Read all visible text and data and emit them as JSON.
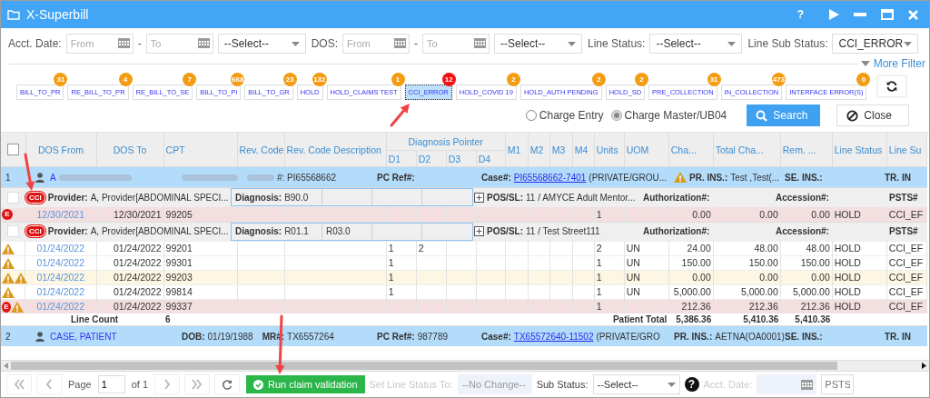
{
  "window": {
    "title": "X-Superbill"
  },
  "title_controls": [
    {
      "kind": "help",
      "label": "?"
    },
    {
      "kind": "play"
    },
    {
      "kind": "minimize"
    },
    {
      "kind": "maximize"
    },
    {
      "kind": "close"
    }
  ],
  "filters": [
    {
      "kind": "date_range",
      "label": "Acct. Date:",
      "from": {
        "placeholder": "From"
      },
      "separator": "-",
      "to": {
        "placeholder": "To"
      },
      "select": "--Select--"
    },
    {
      "kind": "date_range",
      "label": "DOS:",
      "from": {
        "placeholder": "From"
      },
      "separator": "-",
      "to": {
        "placeholder": "To"
      },
      "select": "--Select--"
    },
    {
      "kind": "select",
      "label": "Line Status:",
      "value": "--Select--"
    },
    {
      "kind": "select",
      "label": "Line Sub Status:",
      "value": "CCI_ERROR"
    }
  ],
  "more_filter": "More Filter",
  "status_chips": [
    {
      "label": "BILL_TO_PR",
      "count": "31",
      "selected": false
    },
    {
      "label": "RE_BILL_TO_PR",
      "count": "4",
      "selected": false
    },
    {
      "label": "RE_BILL_TO_SE",
      "count": "7",
      "selected": false
    },
    {
      "label": "BILL_TO_PI",
      "count": "668",
      "selected": false
    },
    {
      "label": "BILL_TO_GR",
      "count": "23",
      "selected": false
    },
    {
      "label": "HOLD",
      "count": "132",
      "selected": false
    },
    {
      "label": "HOLD_CLAIMS TEST",
      "count": "1",
      "selected": false
    },
    {
      "label": "CCI_ERROR",
      "count": "12",
      "selected": true,
      "arrow": true
    },
    {
      "label": "HOLD_COVID 19",
      "count": "2",
      "selected": false
    },
    {
      "label": "HOLD_AUTH PENDING",
      "count": "2",
      "selected": false
    },
    {
      "label": "HOLD_SD",
      "count": "2",
      "selected": false
    },
    {
      "label": "PRE_COLLECTION",
      "count": "31",
      "selected": false
    },
    {
      "label": "IN_COLLECTION",
      "count": "473",
      "selected": false
    },
    {
      "label": "INTERFACE ERROR(S)",
      "count": "0",
      "selected": false
    }
  ],
  "entry_modes": [
    {
      "label": "Charge Entry",
      "selected": false
    },
    {
      "label": "Charge Master/UB04",
      "selected": true
    }
  ],
  "buttons": [
    {
      "kind": "search",
      "label": "Search"
    },
    {
      "kind": "close",
      "label": "Close"
    }
  ],
  "table": {
    "all_checked": false,
    "columns": [
      {
        "label": "DOS From"
      },
      {
        "label": "DOS To"
      },
      {
        "label": "CPT"
      },
      {
        "label": "Rev. Code"
      },
      {
        "label": "Rev. Code Description"
      },
      {
        "label": "Diagnosis Pointer",
        "children": [
          {
            "label": "D1"
          },
          {
            "label": "D2"
          },
          {
            "label": "D3"
          },
          {
            "label": "D4"
          }
        ]
      },
      {
        "label": "M1"
      },
      {
        "label": "M2"
      },
      {
        "label": "M3"
      },
      {
        "label": "M4"
      },
      {
        "label": "Units"
      },
      {
        "label": "UOM"
      },
      {
        "label": "Cha..."
      },
      {
        "label": "Total Cha..."
      },
      {
        "label": "Rem. ..."
      },
      {
        "label": "Line Status"
      },
      {
        "label": "Line Su"
      }
    ],
    "patients": [
      {
        "number": "1",
        "name": "A",
        "redacted": true,
        "id_fields": [
          {
            "redacted": true
          },
          {
            "redacted": true,
            "value": "#: PI65568662"
          }
        ],
        "fields": [
          {
            "label": "PC Ref#:",
            "warning": false
          },
          {
            "label": "Case#:",
            "link": "PI65568662-7401",
            "value": "(PRIVATE/GROU...",
            "warning": false
          },
          {
            "label": "PR. INS.:",
            "value": "Test ,Test(...",
            "warning": true
          },
          {
            "label": "SE. INS.:",
            "warning": false
          },
          {
            "label": "TR. IN",
            "warning": false
          }
        ],
        "groups": [
          {
            "badge": "CCI",
            "arrow": true,
            "checked": false,
            "provider_label": "Provider:",
            "provider": "A, Provider[ABDOMINAL SPECI...",
            "diagnosis_label": "Diagnosis:",
            "diagnoses": [
              "B90.0"
            ],
            "pos_label": "POS/SL:",
            "pos": "11 / AMYCE Adult Mentor...",
            "authorization": "Authorization#:",
            "accession": "Accession#:",
            "psts": "PSTS#",
            "lines": [
              {
                "kind": "error",
                "flags": [
                  {
                    "kind": "error",
                    "label": "E"
                  }
                ],
                "dos_from": "12/30/2021",
                "dos_to": "12/30/2021",
                "cpt": "99205",
                "units": "1",
                "charge": "0.00",
                "total_charge": "0.00",
                "remaining": "0.00",
                "line_status": "HOLD",
                "line_sub_status": "CCI_EF"
              }
            ]
          },
          {
            "badge": "CCI",
            "checked": false,
            "provider_label": "Provider:",
            "provider": "A, Provider[ABDOMINAL SPECI...",
            "diagnosis_label": "Diagnosis:",
            "diagnoses": [
              "R01.1",
              "R03.0"
            ],
            "pos_label": "POS/SL:",
            "pos": "11 / Test Street111",
            "authorization": "Authorization#:",
            "accession": "Accession#:",
            "psts": "PSTS#",
            "lines": [
              {
                "kind": "plain",
                "flags": [
                  {
                    "kind": "warning"
                  }
                ],
                "dos_from": "01/24/2022",
                "dos_to": "01/24/2022",
                "cpt": "99201",
                "d1": "1",
                "d2": "2",
                "units": "2",
                "uom": "UN",
                "charge": "24.00",
                "total_charge": "48.00",
                "remaining": "48.00",
                "line_status": "HOLD",
                "line_sub_status": "CCI_EF"
              },
              {
                "kind": "plain",
                "flags": [
                  {
                    "kind": "warning"
                  }
                ],
                "dos_from": "01/24/2022",
                "dos_to": "01/24/2022",
                "cpt": "99301",
                "d1": "1",
                "units": "1",
                "uom": "UN",
                "charge": "150.00",
                "total_charge": "150.00",
                "remaining": "150.00",
                "line_status": "HOLD",
                "line_sub_status": "CCI_EF"
              },
              {
                "kind": "warning",
                "flags": [
                  {
                    "kind": "warning"
                  },
                  {
                    "kind": "warning"
                  }
                ],
                "dos_from": "01/24/2022",
                "dos_to": "01/24/2022",
                "cpt": "99203",
                "d1": "1",
                "units": "1",
                "uom": "UN",
                "charge": "0.00",
                "total_charge": "0.00",
                "remaining": "0.00",
                "line_status": "HOLD",
                "line_sub_status": "CCI_EF"
              },
              {
                "kind": "plain",
                "flags": [
                  {
                    "kind": "warning"
                  }
                ],
                "dos_from": "01/24/2022",
                "dos_to": "01/24/2022",
                "cpt": "99814",
                "d1": "1",
                "units": "1",
                "uom": "UN",
                "charge": "5,000.00",
                "total_charge": "5,000.00",
                "remaining": "5,000.00",
                "line_status": "HOLD",
                "line_sub_status": "CCI_EF"
              },
              {
                "kind": "error",
                "flags": [
                  {
                    "kind": "error",
                    "label": "E"
                  },
                  {
                    "kind": "warning"
                  }
                ],
                "dos_from": "01/24/2022",
                "dos_to": "01/24/2022",
                "cpt": "99337",
                "units": "1",
                "charge": "212.36",
                "total_charge": "212.36",
                "remaining": "212.36",
                "line_status": "HOLD",
                "line_sub_status": "CCI_EF"
              }
            ]
          }
        ],
        "totals": {
          "line_count_label": "Line Count",
          "line_count": "6",
          "total_label": "Patient Total",
          "charge": "5,386.36",
          "total_charge": "5,410.36",
          "remaining": "5,410.36"
        }
      },
      {
        "number": "2",
        "name": "CASE, PATIENT",
        "redacted": false,
        "id_fields": [
          {
            "redacted": false,
            "label": "DOB:",
            "value": "01/19/1988"
          },
          {
            "redacted": false,
            "label": "MR#:",
            "value": "TX6557264"
          }
        ],
        "fields": [
          {
            "label": "PC Ref#:",
            "value": "987789",
            "warning": false
          },
          {
            "label": "Case#:",
            "link": "TX65572640-11502",
            "value": "(PRIVATE/GRO",
            "warning": false
          },
          {
            "label": "PR. INS.:",
            "value": "AETNA(OA0001)",
            "warning": false
          },
          {
            "label": "SE. INS.:",
            "warning": false
          },
          {
            "label": "TR. IN",
            "warning": false
          }
        ]
      }
    ]
  },
  "footer": {
    "page_label": "Page",
    "page": "1",
    "page_of": "of 1",
    "run_button": {
      "label": "Run claim validation",
      "arrow": true
    },
    "set_status": {
      "label": "Set Line Status To:",
      "value": "--No Change--",
      "disabled": true
    },
    "sub_status": {
      "label": "Sub Status:",
      "value": "--Select--",
      "disabled": false
    },
    "acct_date": {
      "label": "Acct. Date:",
      "disabled": true
    },
    "psts": {
      "placeholder": "PSTS"
    }
  }
}
